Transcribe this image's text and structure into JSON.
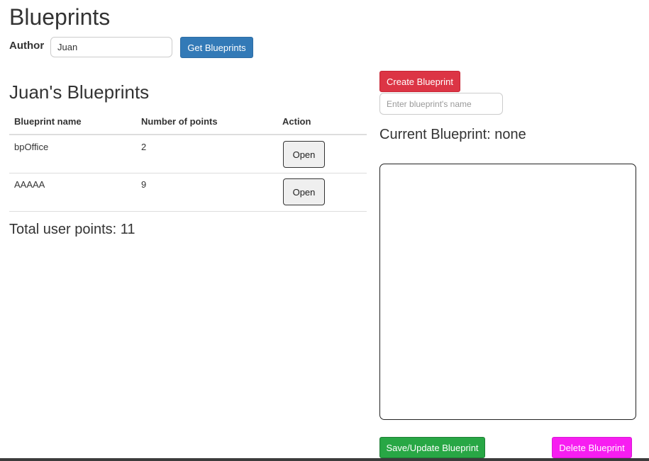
{
  "header": {
    "title": "Blueprints"
  },
  "author_form": {
    "label": "Author",
    "value": "Juan",
    "get_button_label": "Get Blueprints"
  },
  "blueprints": {
    "title": "Juan's Blueprints",
    "columns": [
      "Blueprint name",
      "Number of points",
      "Action"
    ],
    "rows": [
      {
        "name": "bpOffice",
        "points": "2",
        "action_label": "Open"
      },
      {
        "name": "AAAAA",
        "points": "9",
        "action_label": "Open"
      }
    ],
    "total_points_text": "Total user points: 11"
  },
  "editor": {
    "create_button_label": "Create Blueprint",
    "name_placeholder": "Enter blueprint's name",
    "name_value": "",
    "current_blueprint_text": "Current Blueprint: none",
    "save_button_label": "Save/Update Blueprint",
    "delete_button_label": "Delete Blueprint"
  },
  "colors": {
    "primary": "#337ab7",
    "danger": "#dc3545",
    "success": "#28a745",
    "magenta": "#f71ef1"
  }
}
